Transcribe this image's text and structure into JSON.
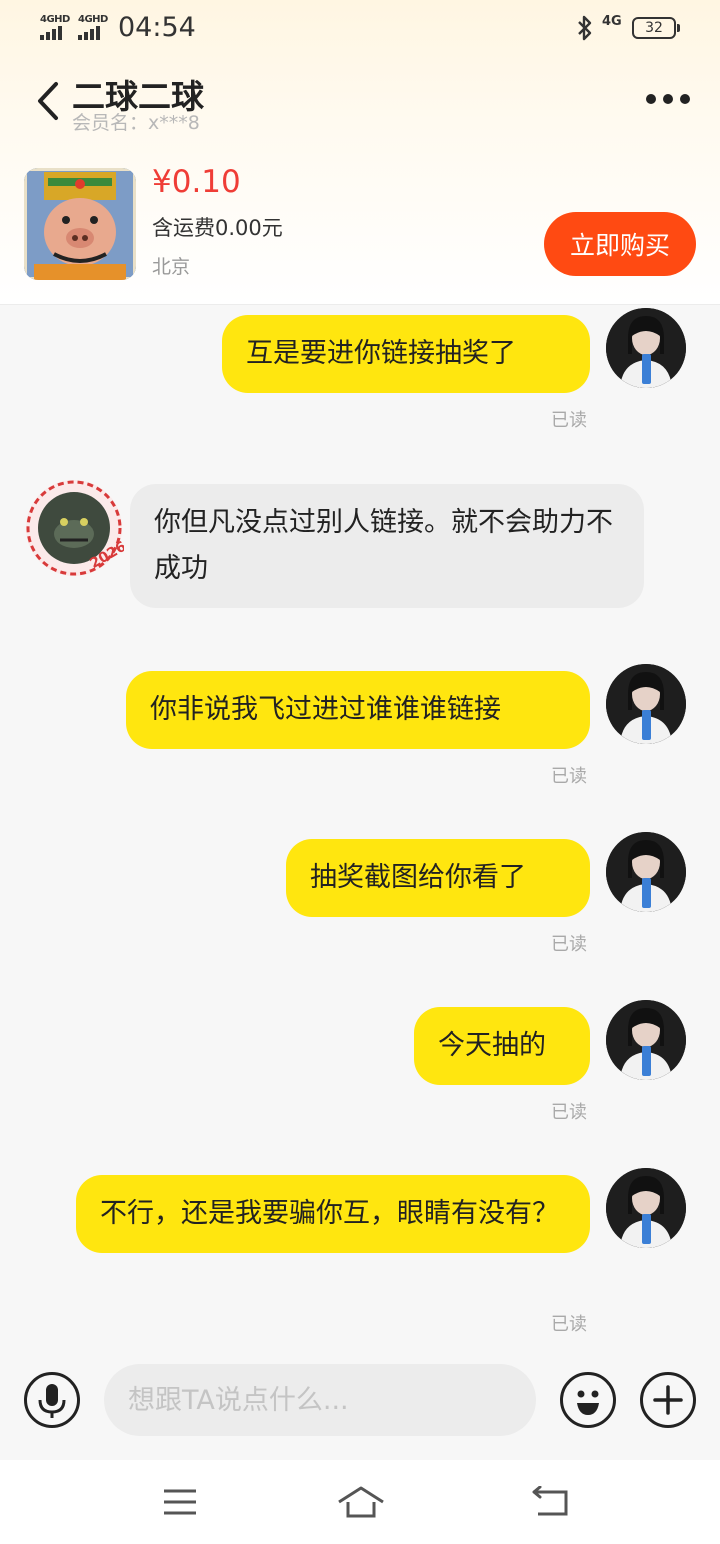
{
  "status_bar": {
    "sim1": "4GHD",
    "sim2": "4GHD",
    "time": "04:54",
    "network": "4G",
    "battery": "32"
  },
  "header": {
    "back_icon": "chevron-left-icon",
    "title": "二球二球",
    "member_name": "会员名：x***8",
    "more_icon": "more-dots-icon"
  },
  "product": {
    "price": "¥0.10",
    "shipping": "含运费0.00元",
    "location": "北京",
    "buy_label": "立即购买",
    "accent_color": "#ff4a12",
    "price_color": "#ef3d36"
  },
  "messages": [
    {
      "sender": "me",
      "text": "互是要进你链接抽奖了",
      "status": "已读"
    },
    {
      "sender": "other",
      "text": "你但凡没点过别人链接。就不会助力不成功"
    },
    {
      "sender": "me",
      "text": "你非说我飞过进过谁谁谁链接",
      "status": "已读"
    },
    {
      "sender": "me",
      "text": "抽奖截图给你看了",
      "status": "已读"
    },
    {
      "sender": "me",
      "text": "今天抽的",
      "status": "已读"
    },
    {
      "sender": "me",
      "text": "不行，还是我要骗你互，眼睛有没有？",
      "status": "已读"
    }
  ],
  "input_bar": {
    "voice_icon": "microphone-icon",
    "placeholder": "想跟TA说点什么...",
    "emoji_icon": "smiley-icon",
    "plus_icon": "plus-icon"
  },
  "nav_bar": {
    "menu_icon": "menu-icon",
    "home_icon": "home-icon",
    "back_icon": "back-arrow-icon"
  },
  "bubble_color_me": "#ffe60f",
  "bubble_color_other": "#ececec"
}
